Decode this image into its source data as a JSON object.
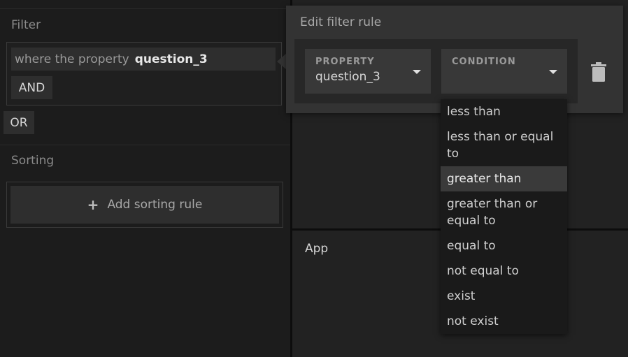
{
  "filter": {
    "title": "Filter",
    "rule_prefix": "where the property",
    "rule_property": "question_3",
    "and_label": "AND",
    "or_label": "OR"
  },
  "sorting": {
    "title": "Sorting",
    "add_label": "Add sorting rule"
  },
  "app": {
    "label": "App"
  },
  "edit_rule": {
    "title": "Edit filter rule",
    "property_caption": "PROPERTY",
    "property_value": "question_3",
    "condition_caption": "CONDITION",
    "condition_value": ""
  },
  "condition_options": {
    "o1": "less than",
    "o2a": "less than or equal",
    "o2b": "to",
    "o3": "greater than",
    "o4a": "greater than or",
    "o4b": "equal to",
    "o5": "equal to",
    "o6": "not equal to",
    "o7": "exist",
    "o8": "not exist",
    "highlighted": "greater than"
  },
  "colors": {
    "background": "#1c1c1c",
    "panel": "#222222",
    "popover": "#333333",
    "dropdown": "#1a1a1a",
    "highlight": "#3a3a3a"
  }
}
